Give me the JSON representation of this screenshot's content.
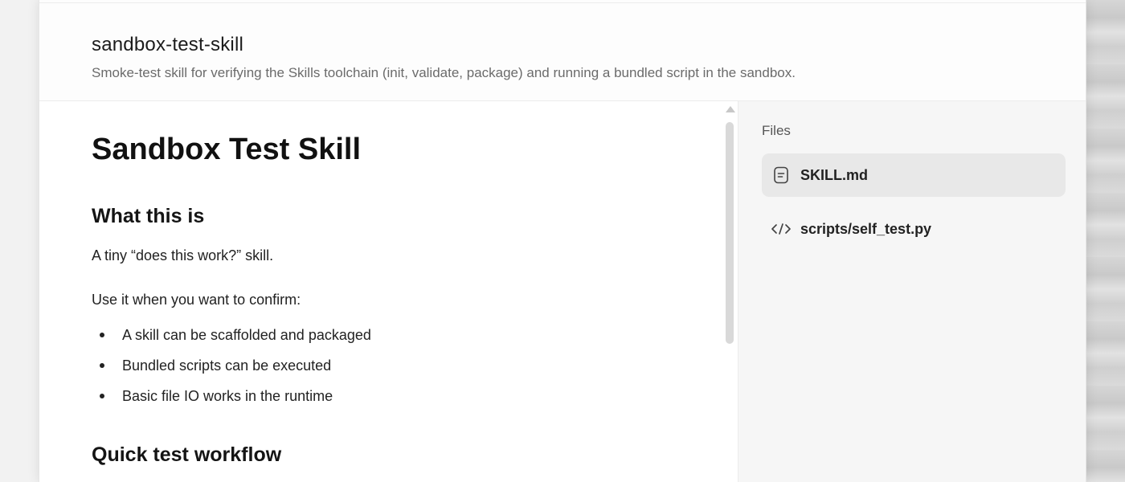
{
  "header": {
    "skill_name": "sandbox-test-skill",
    "description": "Smoke-test skill for verifying the Skills toolchain (init, validate, package) and running a bundled script in the sandbox."
  },
  "document": {
    "title": "Sandbox Test Skill",
    "section1_heading": "What this is",
    "intro": "A tiny “does this work?” skill.",
    "use_it": "Use it when you want to confirm:",
    "bullets": [
      "A skill can be scaffolded and packaged",
      "Bundled scripts can be executed",
      "Basic file IO works in the runtime"
    ],
    "section2_heading": "Quick test workflow"
  },
  "files": {
    "title": "Files",
    "items": [
      {
        "label": "SKILL.md",
        "icon": "file-text-icon",
        "selected": true
      },
      {
        "label": "scripts/self_test.py",
        "icon": "code-icon",
        "selected": false
      }
    ]
  }
}
